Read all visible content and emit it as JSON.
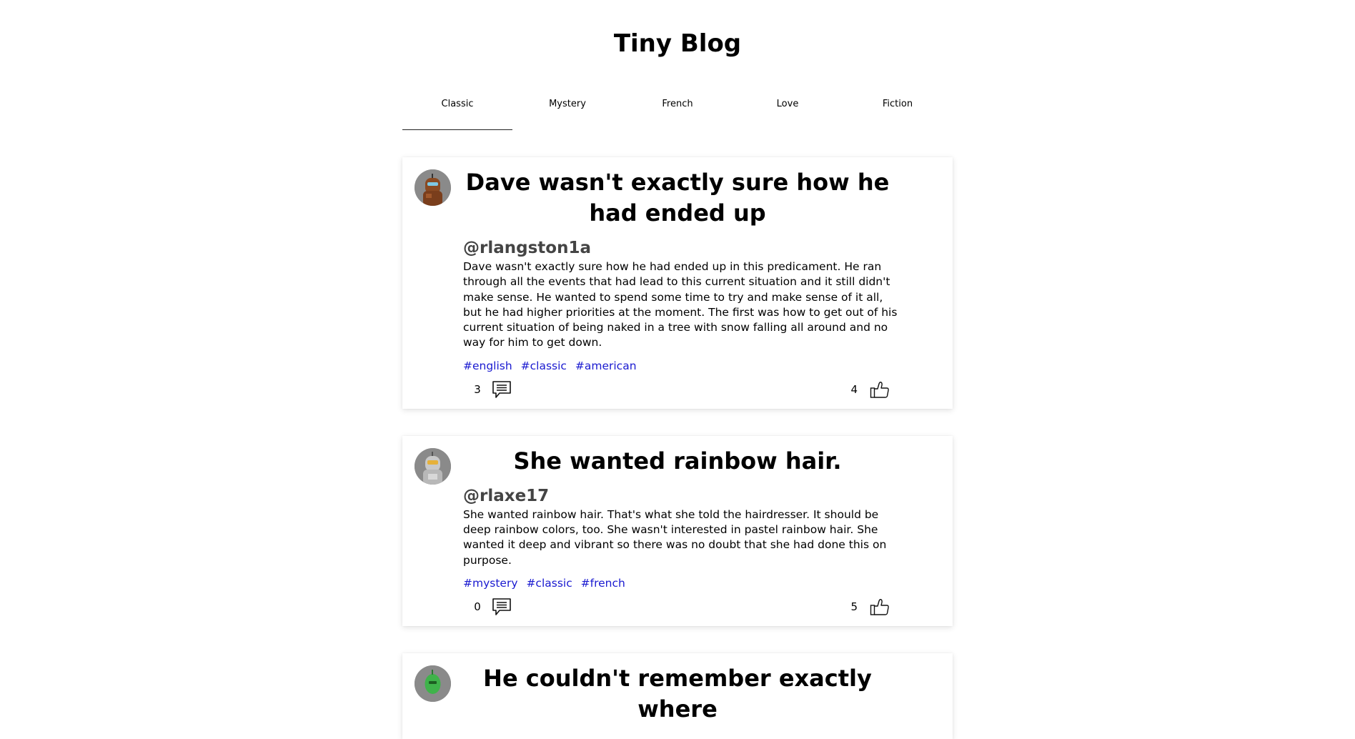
{
  "app": {
    "title": "Tiny Blog"
  },
  "tabs": [
    {
      "label": "Classic",
      "active": true
    },
    {
      "label": "Mystery",
      "active": false
    },
    {
      "label": "French",
      "active": false
    },
    {
      "label": "Love",
      "active": false
    },
    {
      "label": "Fiction",
      "active": false
    }
  ],
  "posts": [
    {
      "title": "Dave wasn't exactly sure how he had ended up",
      "author": "@rlangston1a",
      "avatar_icon": "robot-avatar-icon",
      "text": "Dave wasn't exactly sure how he had ended up in this predicament. He ran through all the events that had lead to this current situation and it still didn't make sense. He wanted to spend some time to try and make sense of it all, but he had higher priorities at the moment. The first was how to get out of his current situation of being naked in a tree with snow falling all around and no way for him to get down.",
      "tags": [
        "#english",
        "#classic",
        "#american"
      ],
      "comments": "3",
      "likes": "4"
    },
    {
      "title": "She wanted rainbow hair.",
      "author": "@rlaxe17",
      "avatar_icon": "robot-avatar-icon",
      "text": "She wanted rainbow hair. That's what she told the hairdresser. It should be deep rainbow colors, too. She wasn't interested in pastel rainbow hair. She wanted it deep and vibrant so there was no doubt that she had done this on purpose.",
      "tags": [
        "#mystery",
        "#classic",
        "#french"
      ],
      "comments": "0",
      "likes": "5"
    },
    {
      "title": "He couldn't remember exactly where",
      "avatar_icon": "robot-avatar-icon"
    }
  ],
  "colors": {
    "tag": "#1a1ad0",
    "author": "#444444",
    "avatar_bg": "#8a8a8a"
  }
}
